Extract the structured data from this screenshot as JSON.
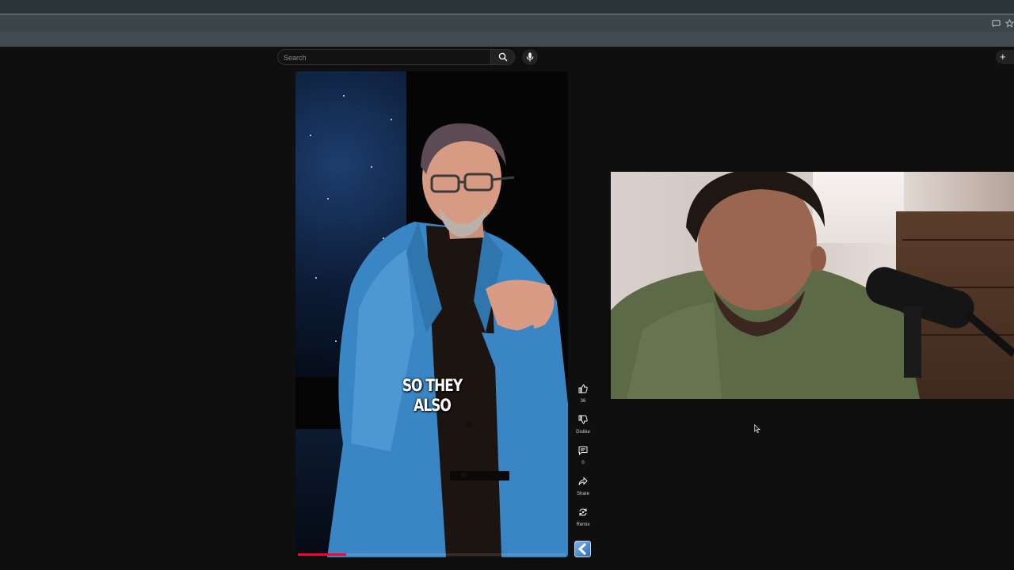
{
  "search": {
    "placeholder": "Search"
  },
  "short": {
    "caption": "SO THEY ALSO",
    "progress_fraction": 0.18
  },
  "actions": {
    "like_count": "36",
    "dislike_label": "Dislike",
    "comment_count": "0",
    "share_label": "Share",
    "remix_label": "Remix"
  },
  "icons": {
    "search": "search-icon",
    "mic": "microphone-icon",
    "create": "plus-icon",
    "like": "thumbs-up-icon",
    "dislike": "thumbs-down-icon",
    "comment": "comment-icon",
    "share": "share-icon",
    "remix": "remix-icon",
    "cast": "cast-icon",
    "bookmark": "star-icon"
  },
  "colors": {
    "page_bg": "#0f0f0f",
    "progress": "#ff0033",
    "browser_tabstrip": "#2b3436",
    "browser_toolbar": "#3b464b"
  }
}
